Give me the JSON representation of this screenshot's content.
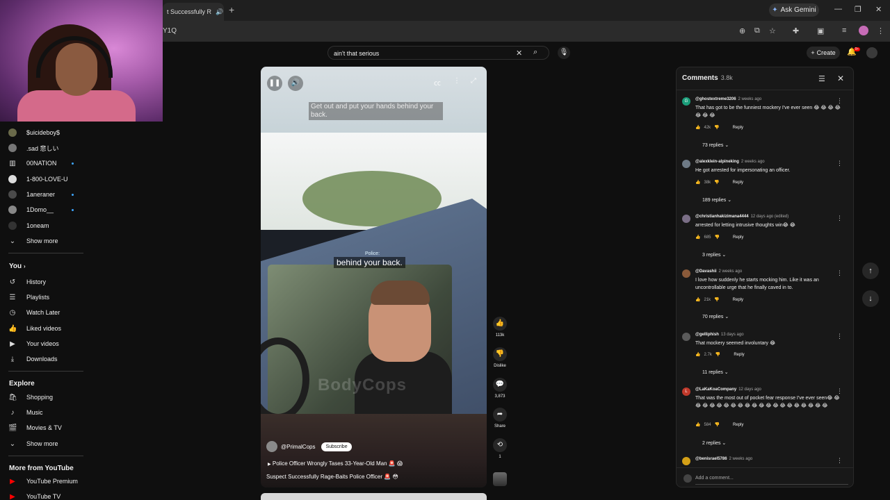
{
  "browser": {
    "tab_title": "t Successfully R",
    "new_tab": "+",
    "gemini_label": "Ask Gemini",
    "url": "Y1Q",
    "colors": {
      "tab_bg": "#2b2b2b",
      "profile": "#c66bb6"
    }
  },
  "youtube": {
    "search": {
      "query": "ain't that serious",
      "clear_icon": "close-icon",
      "search_icon": "search-icon"
    },
    "create_label": "Create",
    "notification_badge": "9+",
    "sidebar": {
      "subscriptions": [
        {
          "name": "$uicideboy$",
          "dot": false
        },
        {
          "name": ".sad 悲しい",
          "dot": false
        },
        {
          "name": "00NATION",
          "dot": true
        },
        {
          "name": "1-800-LOVE-U",
          "dot": false
        },
        {
          "name": "1aneraner",
          "dot": true
        },
        {
          "name": "1Domo__",
          "dot": true
        },
        {
          "name": "1oneam",
          "dot": false
        }
      ],
      "subs_show_more": "Show more",
      "you_heading": "You",
      "you_items": [
        "History",
        "Playlists",
        "Watch Later",
        "Liked videos",
        "Your videos",
        "Downloads"
      ],
      "explore_heading": "Explore",
      "explore_items": [
        "Shopping",
        "Music",
        "Movies & TV"
      ],
      "explore_show_more": "Show more",
      "more_heading": "More from YouTube",
      "more_items": [
        "YouTube Premium",
        "YouTube TV"
      ]
    },
    "video": {
      "caption_top": "Get out and put your hands behind your back.",
      "caption_speaker": "Police:",
      "caption_main": "behind your back.",
      "watermark": "BodyCops",
      "channel": "@PrimalCops",
      "subscribe_label": "Subscribe",
      "playlist_title": "Police Officer Wrongly Tases 33-Year-Old Man 🚨 😱",
      "title": "Suspect Successfully Rage-Baits Police Officer 🚨 😳"
    },
    "actions": {
      "like_count": "113k",
      "dislike_label": "Dislike",
      "comment_count": "3,873",
      "share_label": "Share",
      "remix_count": "1"
    },
    "comments": {
      "heading": "Comments",
      "count": "3.8k",
      "add_placeholder": "Add a comment...",
      "reply_label": "Reply",
      "items": [
        {
          "user": "@ghostextreme3206",
          "time": "2 weeks ago",
          "text": "That has got to be the funniest mockery I've ever seen 😂 😂 😂 😂 😂 😂 😂",
          "likes": "42k",
          "replies": "73 replies",
          "avatar_color": "#1a9e7a",
          "avatar_letter": "G"
        },
        {
          "user": "@alexklein-alpineking",
          "time": "2 weeks ago",
          "text": "He got arrested for impersonating an officer.",
          "likes": "38k",
          "replies": "189 replies",
          "avatar_color": "#6e7a86",
          "avatar_letter": ""
        },
        {
          "user": "@christianhakizimana4444",
          "time": "12 days ago (edited)",
          "text": "arrested for letting intrusive thoughts win😂 😂",
          "likes": "685",
          "replies": "3 replies",
          "avatar_color": "#7a6e86",
          "avatar_letter": ""
        },
        {
          "user": "@Davashii",
          "time": "2 weeks ago",
          "text": "I love how suddenly he starts mocking him. Like it was an uncontrollable urge that he finally caved in to.",
          "likes": "21k",
          "replies": "70 replies",
          "avatar_color": "#8a5a3a",
          "avatar_letter": ""
        },
        {
          "user": "@gelliphish",
          "time": "13 days ago",
          "text": "That mockery seemed involuntary 😂",
          "likes": "2.7k",
          "replies": "11 replies",
          "avatar_color": "#5a5a5a",
          "avatar_letter": ""
        },
        {
          "user": "@LaKaKoaCompany",
          "time": "12 days ago",
          "text": "That was the most out of pocket fear response I've ever seen😂 😂 😂 😂 😂 😂 😂 😂 😂 😂 😂 😂 😂 😂 😂 😂 😂 😂 😂 😂 😂",
          "likes": "584",
          "replies": "2 replies",
          "avatar_color": "#c0392b",
          "avatar_letter": "L"
        },
        {
          "user": "@benisrael5786",
          "time": "2 weeks ago",
          "text": "",
          "likes": "",
          "replies": "",
          "avatar_color": "#d4a017",
          "avatar_letter": ""
        }
      ]
    }
  }
}
